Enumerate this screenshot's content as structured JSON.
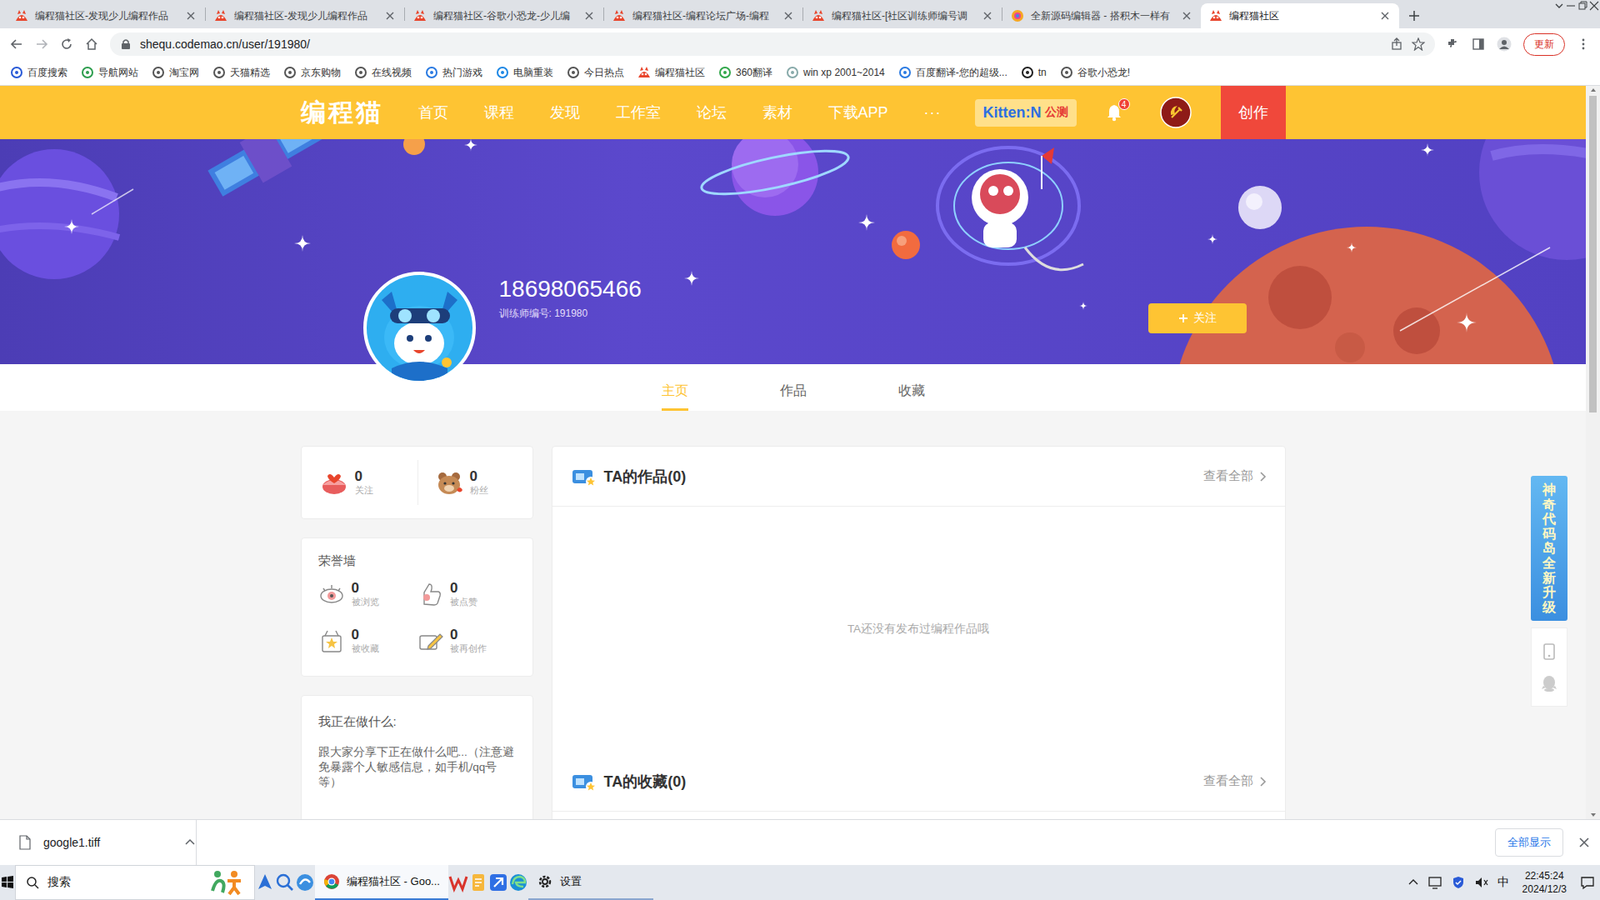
{
  "browser": {
    "tabs": [
      {
        "label": "编程猫社区-发现少儿编程作品",
        "selected": false
      },
      {
        "label": "编程猫社区-发现少儿编程作品",
        "selected": false
      },
      {
        "label": "编程猫社区-谷歌小恐龙-少儿编",
        "selected": false
      },
      {
        "label": "编程猫社区-编程论坛广场-编程",
        "selected": false
      },
      {
        "label": "编程猫社区-[社区训练师编号调",
        "selected": false
      },
      {
        "label": "全新源码编辑器 - 搭积木一样有",
        "selected": false
      },
      {
        "label": "编程猫社区",
        "selected": true
      }
    ],
    "url": "shequ.codemao.cn/user/191980/",
    "update_button": "更新",
    "bookmarks": [
      "百度搜索",
      "导航网站",
      "淘宝网",
      "天猫精选",
      "京东购物",
      "在线视频",
      "热门游戏",
      "电脑重装",
      "今日热点",
      "编程猫社区",
      "360翻译",
      "win xp 2001~2014",
      "百度翻译-您的超级...",
      "tn",
      "谷歌小恐龙!"
    ]
  },
  "header": {
    "logo": "编程猫",
    "nav": [
      "首页",
      "课程",
      "发现",
      "工作室",
      "论坛",
      "素材",
      "下载APP"
    ],
    "more": "···",
    "kitten": "Kitten:N",
    "kitten_tag": "公测",
    "notifications": "4",
    "create": "创作"
  },
  "profile": {
    "username": "18698065466",
    "trainer_id": "训练师编号: 191980",
    "follow": "关注"
  },
  "profile_tabs": [
    {
      "label": "主页",
      "selected": true
    },
    {
      "label": "作品",
      "selected": false
    },
    {
      "label": "收藏",
      "selected": false
    }
  ],
  "social": [
    {
      "value": "0",
      "label": "关注"
    },
    {
      "value": "0",
      "label": "粉丝"
    }
  ],
  "honor": {
    "title": "荣誉墙",
    "items": [
      {
        "value": "0",
        "label": "被浏览"
      },
      {
        "value": "0",
        "label": "被点赞"
      },
      {
        "value": "0",
        "label": "被收藏"
      },
      {
        "value": "0",
        "label": "被再创作"
      }
    ]
  },
  "status_card": {
    "title": "我正在做什么:",
    "text": "跟大家分享下正在做什么吧...（注意避免暴露个人敏感信息，如手机/qq号等）"
  },
  "works": {
    "title": "TA的作品(0)",
    "more": "查看全部",
    "empty": "TA还没有发布过编程作品哦"
  },
  "favorites": {
    "title": "TA的收藏(0)",
    "more": "查看全部"
  },
  "side_promo": "神奇代码岛全新升级",
  "download": {
    "file": "google1.tiff",
    "show_all": "全部显示"
  },
  "taskbar": {
    "search": "搜索",
    "windows": [
      {
        "label": "编程猫社区 - Goo...",
        "selected": true
      },
      {
        "label": "设置",
        "selected": false
      }
    ],
    "ime": "中",
    "time": "22:45:24",
    "date": "2024/12/3"
  }
}
